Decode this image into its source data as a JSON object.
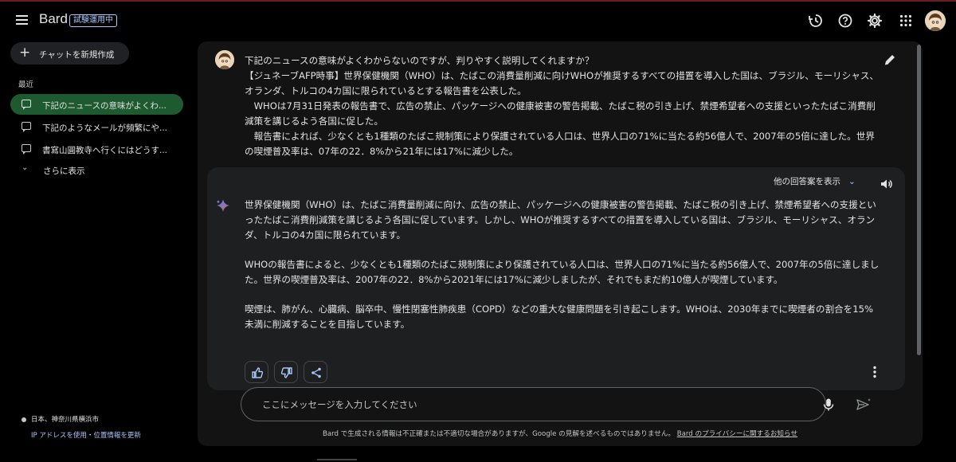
{
  "header": {
    "app_title": "Bard",
    "badge": "試験運用中",
    "icons": [
      "menu-icon",
      "history-icon",
      "help-icon",
      "settings-icon",
      "apps-grid-icon",
      "account-avatar"
    ]
  },
  "sidebar": {
    "new_chat_label": "チャットを新規作成",
    "recent_heading": "最近",
    "conversations": [
      {
        "label": "下記のニュースの意味がよくわ..."
      },
      {
        "label": "下記のようなメールが頻繁にや..."
      },
      {
        "label": "書寫山圓教寺へ行くにはどうす..."
      }
    ],
    "show_more_label": "さらに表示",
    "location": "日本、神奈川県横浜市",
    "location_link": "IP アドレスを使用・位置情報を更新"
  },
  "user_message": {
    "paragraphs": [
      "下記のニュースの意味がよくわからないのですが、判りやすく説明してくれますか？",
      "【ジュネーブAFP時事】世界保健機関（WHO）は、たばこの消費量削減に向けWHOが推奨するすべての措置を導入した国は、ブラジル、モーリシャス、オランダ、トルコの4カ国に限られているとする報告書を公表した。",
      "　WHOは7月31日発表の報告書で、広告の禁止、パッケージへの健康被害の警告掲載、たばこ税の引き上げ、禁煙希望者への支援といったたばこ消費削減策を講じるよう各国に促した。",
      "　報告書によれば、少なくとも1種類のたばこ規制策により保護されている人口は、世界人口の71%に当たる約56億人で、2007年の5倍に達した。世界の喫煙普及率は、07年の22．8%から21年には17%に減少した。"
    ]
  },
  "response": {
    "drafts_label": "他の回答案を表示",
    "paragraphs": [
      "世界保健機関（WHO）は、たばこ消費量削減に向け、広告の禁止、パッケージへの健康被害の警告掲載、たばこ税の引き上げ、禁煙希望者への支援といったたばこ消費削減策を講じるよう各国に促しています。しかし、WHOが推奨するすべての措置を導入している国は、ブラジル、モーリシャス、オランダ、トルコの4カ国に限られています。",
      "WHOの報告書によると、少なくとも1種類のたばこ規制策により保護されている人口は、世界人口の71%に当たる約56億人で、2007年の5倍に達しました。世界の喫煙普及率は、2007年の22．8%から2021年には17%に減少しましたが、それでもまだ約10億人が喫煙しています。",
      "喫煙は、肺がん、心臓病、脳卒中、慢性閉塞性肺疾患（COPD）などの重大な健康問題を引き起こします。WHOは、2030年までに喫煙者の割合を15%未満に削減することを目指しています。"
    ]
  },
  "input": {
    "placeholder": "ここにメッセージを入力してください"
  },
  "footer": {
    "disclaimer": "Bard で生成される情報は不正確または不適切な場合がありますが、Google の見解を述べるものではありません。",
    "privacy_link": "Bard のプライバシーに関するお知らせ"
  },
  "colors": {
    "background": "#000000",
    "panel": "#131314",
    "response_card": "#1e1f20",
    "active_item": "#1e5a2f",
    "link": "#a8c7fa"
  }
}
